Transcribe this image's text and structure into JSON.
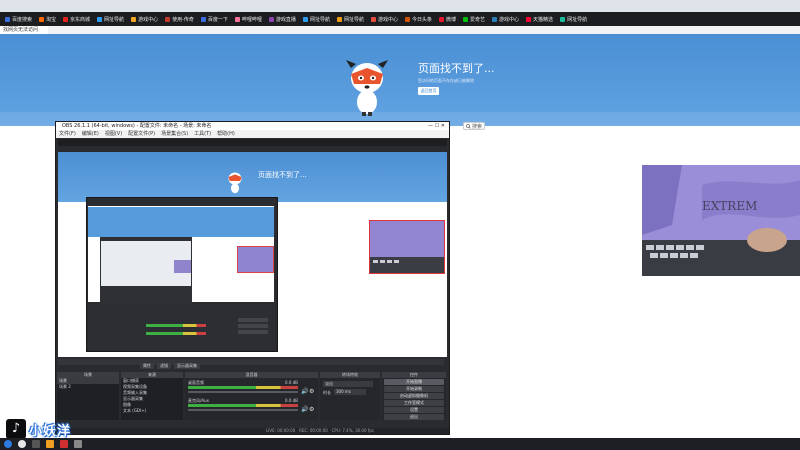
{
  "browser": {
    "tab_title": "找网页无法访问",
    "bookmarks": [
      {
        "label": "百度搜索",
        "color": "#3b6fe0"
      },
      {
        "label": "淘宝",
        "color": "#ff6a00"
      },
      {
        "label": "京东商城",
        "color": "#e1251b"
      },
      {
        "label": "网址导航",
        "color": "#2f9cf3"
      },
      {
        "label": "游戏中心",
        "color": "#f5a623"
      },
      {
        "label": "使用-传奇",
        "color": "#c0392b"
      },
      {
        "label": "百度一下",
        "color": "#3b6fe0"
      },
      {
        "label": "哔哩哔哩",
        "color": "#fb7299"
      },
      {
        "label": "游戏直播",
        "color": "#8e44ad"
      },
      {
        "label": "网址导航",
        "color": "#2f9cf3"
      },
      {
        "label": "网址导航",
        "color": "#f39c12"
      },
      {
        "label": "游戏中心",
        "color": "#e74c3c"
      },
      {
        "label": "今日头条",
        "color": "#d35400"
      },
      {
        "label": "微博",
        "color": "#e6162d"
      },
      {
        "label": "爱奇艺",
        "color": "#00be06"
      },
      {
        "label": "游戏中心",
        "color": "#2980b9"
      },
      {
        "label": "天猫精选",
        "color": "#ff0036"
      },
      {
        "label": "网址导航",
        "color": "#1abc9c"
      }
    ]
  },
  "error_page": {
    "title": "页面找不到了...",
    "subtitle": "您访问的页面不存在或已被删除",
    "home_button": "返回首页",
    "search_button": "搜索"
  },
  "obs": {
    "window_title": "OBS 26.1.1 (64-bit, windows) - 配置文件: 未命名 - 场景: 未命名",
    "menu": [
      "文件(F)",
      "编辑(E)",
      "视图(V)",
      "配置文件(P)",
      "场景集合(S)",
      "工具(T)",
      "帮助(H)"
    ],
    "dock_titles": {
      "scenes": "场景",
      "sources": "来源",
      "mixer": "混音器",
      "transitions": "转场特效",
      "controls": "控件"
    },
    "scenes": [
      "场景",
      "场景 2"
    ],
    "sources": [
      "窗口捕获",
      "视频采集设备",
      "音频输入采集",
      "显示器采集",
      "图像",
      "文本 (GDI+)"
    ],
    "scene_tabs": [
      "属性",
      "滤镜",
      "显示器采集"
    ],
    "mixer": [
      "桌面音频",
      "麦克风/Aux"
    ],
    "mixer_db": [
      "0.0 dB",
      "0.0 dB"
    ],
    "transition": "淡出",
    "transition_duration_label": "时长",
    "transition_duration": "300 ms",
    "controls": [
      "开始直播",
      "开始录制",
      "启动虚拟摄像机",
      "工作室模式",
      "设置",
      "退出"
    ],
    "status": {
      "live": "LIVE: 00:00:00",
      "rec": "REC: 00:00:00",
      "cpu": "CPU: 7.4%, 30.00 fps"
    }
  },
  "watermark": {
    "logo": "♪",
    "text": "小妖洋"
  },
  "theme": {
    "banner": "#4a8ed4",
    "obs_bg": "#2b2c30",
    "taskbar": "#1d1f24"
  }
}
